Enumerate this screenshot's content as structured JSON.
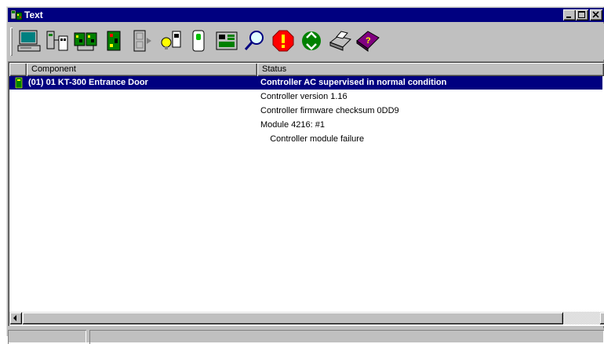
{
  "window": {
    "title": "Text",
    "icon": "app-icon",
    "controls": [
      "minimize-icon",
      "maximize-icon",
      "close-icon"
    ]
  },
  "toolbar": {
    "buttons": [
      {
        "name": "computer-button",
        "icon": "computer-icon"
      },
      {
        "name": "network-devices-button",
        "icon": "network-devices-icon"
      },
      {
        "name": "controllers-button",
        "icon": "controllers-icon"
      },
      {
        "name": "circuit-board-button",
        "icon": "circuit-board-icon"
      },
      {
        "name": "door-button",
        "icon": "door-icon"
      },
      {
        "name": "reader-light-button",
        "icon": "reader-light-icon"
      },
      {
        "name": "card-reader-button",
        "icon": "card-reader-icon"
      },
      {
        "name": "module-button",
        "icon": "module-icon"
      },
      {
        "name": "search-button",
        "icon": "magnifier-icon"
      },
      {
        "name": "stop-button",
        "icon": "stop-sign-icon"
      },
      {
        "name": "recycle-button",
        "icon": "recycle-icon"
      },
      {
        "name": "print-button",
        "icon": "printer-icon"
      },
      {
        "name": "help-button",
        "icon": "help-book-icon"
      }
    ]
  },
  "list": {
    "columns": [
      "Component",
      "Status"
    ],
    "rows": [
      {
        "component": "(01) 01 KT-300 Entrance Door",
        "status": "Controller AC supervised in normal condition",
        "selected": true
      },
      {
        "component": "",
        "status": "Controller version 1.16"
      },
      {
        "component": "",
        "status": "Controller firmware checksum 0DD9"
      },
      {
        "component": "",
        "status": "Module 4216: #1"
      },
      {
        "component": "",
        "status": "    Controller module failure"
      }
    ]
  },
  "colors": {
    "titlebar": "#000080",
    "selection": "#000080",
    "face": "#c0c0c0"
  }
}
